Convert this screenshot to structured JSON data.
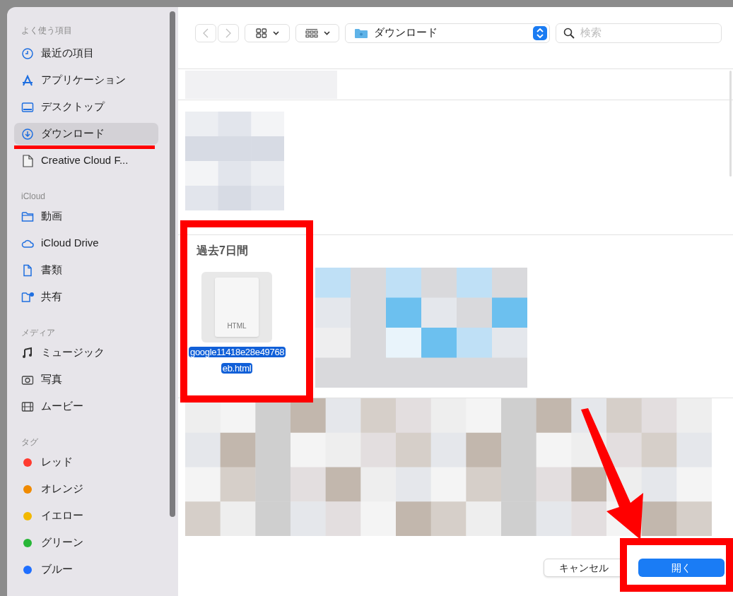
{
  "sidebar": {
    "sections": [
      {
        "heading": "よく使う項目",
        "items": [
          {
            "kind": "clock",
            "label": "最近の項目",
            "selected": false
          },
          {
            "kind": "apps",
            "label": "アプリケーション",
            "selected": false
          },
          {
            "kind": "desktop",
            "label": "デスクトップ",
            "selected": false
          },
          {
            "kind": "download",
            "label": "ダウンロード",
            "selected": true
          },
          {
            "kind": "document",
            "label": "Creative Cloud F...",
            "selected": false
          }
        ]
      },
      {
        "heading": "iCloud",
        "items": [
          {
            "kind": "folder",
            "label": "動画",
            "selected": false
          },
          {
            "kind": "cloud",
            "label": "iCloud Drive",
            "selected": false
          },
          {
            "kind": "file",
            "label": "書類",
            "selected": false
          },
          {
            "kind": "shared",
            "label": "共有",
            "selected": false
          }
        ]
      },
      {
        "heading": "メディア",
        "items": [
          {
            "kind": "music",
            "label": "ミュージック",
            "selected": false
          },
          {
            "kind": "camera",
            "label": "写真",
            "selected": false
          },
          {
            "kind": "film",
            "label": "ムービー",
            "selected": false
          }
        ]
      },
      {
        "heading": "タグ",
        "items": [
          {
            "kind": "tag",
            "label": "レッド",
            "color": "#ff3b30",
            "selected": false
          },
          {
            "kind": "tag",
            "label": "オレンジ",
            "color": "#f08a00",
            "selected": false
          },
          {
            "kind": "tag",
            "label": "イエロー",
            "color": "#f2b800",
            "selected": false
          },
          {
            "kind": "tag",
            "label": "グリーン",
            "color": "#28b637",
            "selected": false
          },
          {
            "kind": "tag",
            "label": "ブルー",
            "color": "#1f6fff",
            "selected": false
          }
        ]
      }
    ]
  },
  "toolbar": {
    "location": "ダウンロード",
    "search": {
      "placeholder": "検索"
    }
  },
  "files": {
    "section_heading": "過去7日間",
    "selected_file": {
      "type_label": "HTML",
      "name": "google11418e28e49768eb.html",
      "selected": true
    }
  },
  "buttons": {
    "cancel": "キャンセル",
    "open": "開く"
  }
}
